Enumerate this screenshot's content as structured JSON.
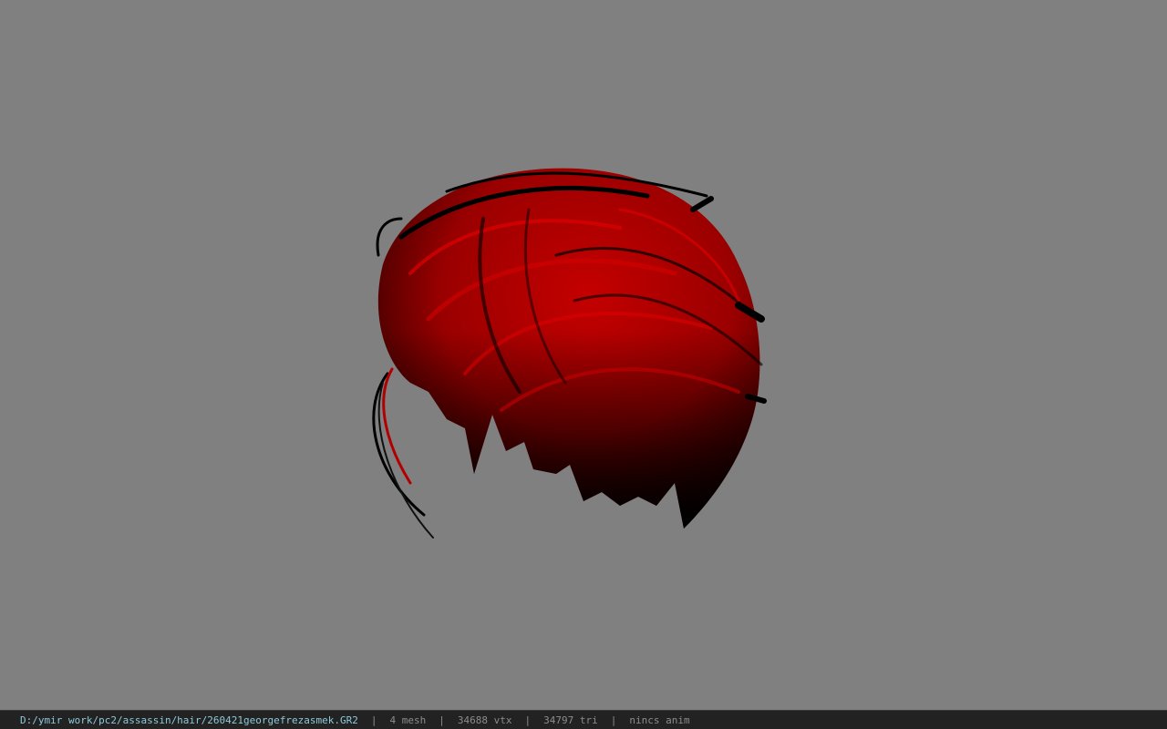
{
  "viewport": {
    "background_color": "#808080",
    "model": {
      "name": "hair-mesh",
      "hair_color": "#c00000",
      "shadow_color": "#000000"
    }
  },
  "statusbar": {
    "file_path": "D:/ymir work/pc2/assassin/hair/260421georgefrezasmek.GR2",
    "separator": "|",
    "mesh_count": "4 mesh",
    "vertex_count": "34688 vtx",
    "triangle_count": "34797 tri",
    "anim_status": "nincs anim"
  }
}
